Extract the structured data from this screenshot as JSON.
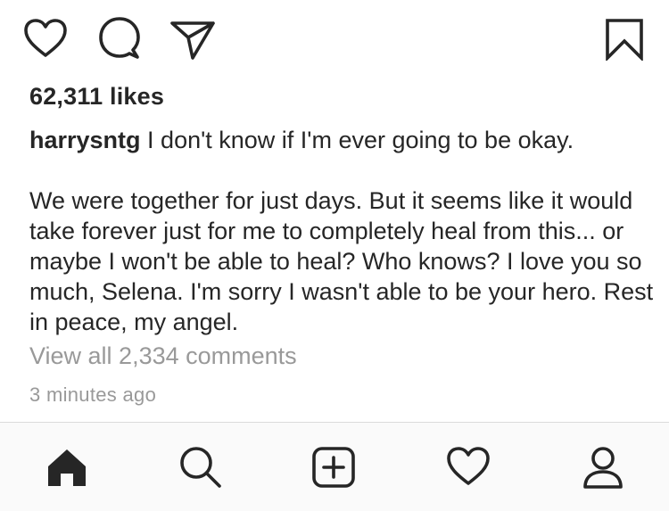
{
  "post": {
    "likes_text": "62,311 likes",
    "username": "harrysntg",
    "caption": " I don't know if I'm ever going to be okay.\n\nWe were together for just days. But it seems like it would take forever just for me to completely heal from this... or maybe I won't be able to heal? Who knows? I love you so much, Selena. I'm sorry I wasn't able to be your hero. Rest in peace, my angel.",
    "view_all_comments": "View all 2,334 comments",
    "timestamp": "3 minutes ago"
  },
  "actions": {
    "icons": [
      "heart-icon",
      "comment-bubble-icon",
      "paper-plane-icon",
      "bookmark-icon"
    ]
  },
  "tabbar": {
    "items": [
      "home-icon",
      "search-icon",
      "new-post-icon",
      "activity-heart-icon",
      "profile-icon"
    ]
  },
  "colors": {
    "text": "#262626",
    "muted": "#999999",
    "tabbar_bg": "#fafafa",
    "divider": "#dbdbdb"
  }
}
